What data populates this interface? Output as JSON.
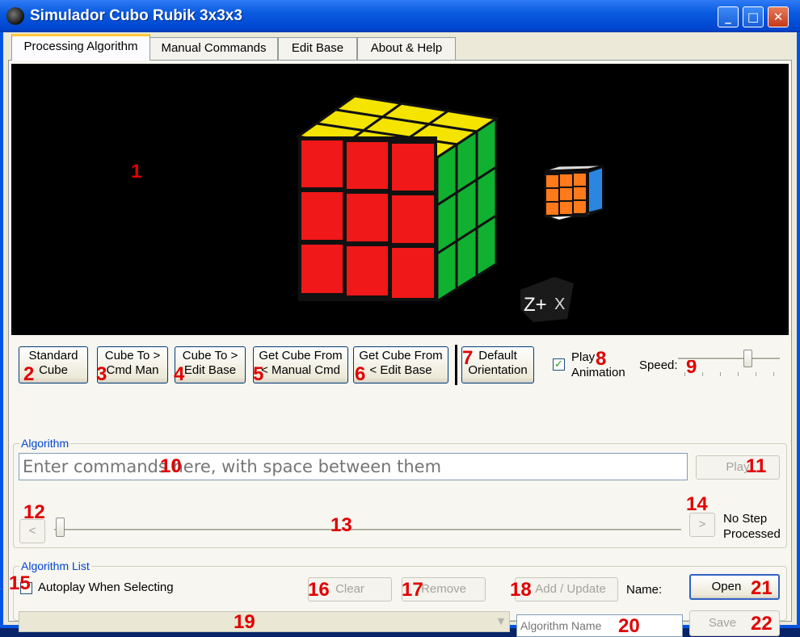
{
  "window": {
    "title": "Simulador Cubo Rubik 3x3x3",
    "minimize": "_",
    "maximize": "□",
    "close": "✕"
  },
  "tabs": [
    {
      "label": "Processing Algorithm"
    },
    {
      "label": "Manual Commands"
    },
    {
      "label": "Edit Base"
    },
    {
      "label": "About & Help"
    }
  ],
  "viewport": {
    "marker": "1",
    "axis_label": "Z+",
    "axis_label_x": "X"
  },
  "cube": {
    "front_color": "#f01818",
    "top_color": "#f4e400",
    "side_color": "#10b030",
    "mini_colors": [
      "#ff7a1a",
      "#2b86e0",
      "#ffffff"
    ]
  },
  "toolbar": {
    "standard_cube": {
      "line1": "Standard",
      "line2": "Cube",
      "marker": "2"
    },
    "cube_to_cmd": {
      "line1": "Cube To >",
      "line2": "Cmd Man",
      "marker": "3"
    },
    "cube_to_base": {
      "line1": "Cube To >",
      "line2": "Edit Base",
      "marker": "4"
    },
    "get_from_manual": {
      "line1": "Get Cube From",
      "line2": "< Manual Cmd",
      "marker": "5"
    },
    "get_from_base": {
      "line1": "Get Cube From",
      "line2": "< Edit Base",
      "marker": "6"
    },
    "default_orientation": {
      "line1": "Default",
      "line2": "Orientation",
      "marker": "7"
    },
    "play_animation": {
      "line1": "Play",
      "line2": "Animation",
      "checked": true,
      "marker": "8"
    },
    "speed": {
      "label": "Speed:",
      "marker": "9",
      "level": 0.7
    }
  },
  "algorithm": {
    "group_label": "Algorithm",
    "placeholder": "Enter commands here, with space between them",
    "input_marker": "10",
    "play_label": "Play",
    "play_marker": "11",
    "prev_label": "<",
    "prev_marker": "12",
    "slider_marker": "13",
    "next_label": ">",
    "next_marker": "14",
    "step_status": {
      "line1": "No Step",
      "line2": "Processed"
    }
  },
  "algorithm_list": {
    "group_label": "Algorithm List",
    "autoplay_label": "Autoplay When Selecting",
    "autoplay_marker": "15",
    "clear_label": "Clear",
    "clear_marker": "16",
    "remove_label": "Remove",
    "remove_marker": "17",
    "add_update_label": "Add / Update",
    "add_update_marker": "18",
    "combo_marker": "19",
    "name_placeholder": "Algorithm Name",
    "name_marker": "20",
    "name_label": "Name:",
    "open_label": "Open",
    "open_marker": "21",
    "save_label": "Save",
    "save_marker": "22"
  }
}
